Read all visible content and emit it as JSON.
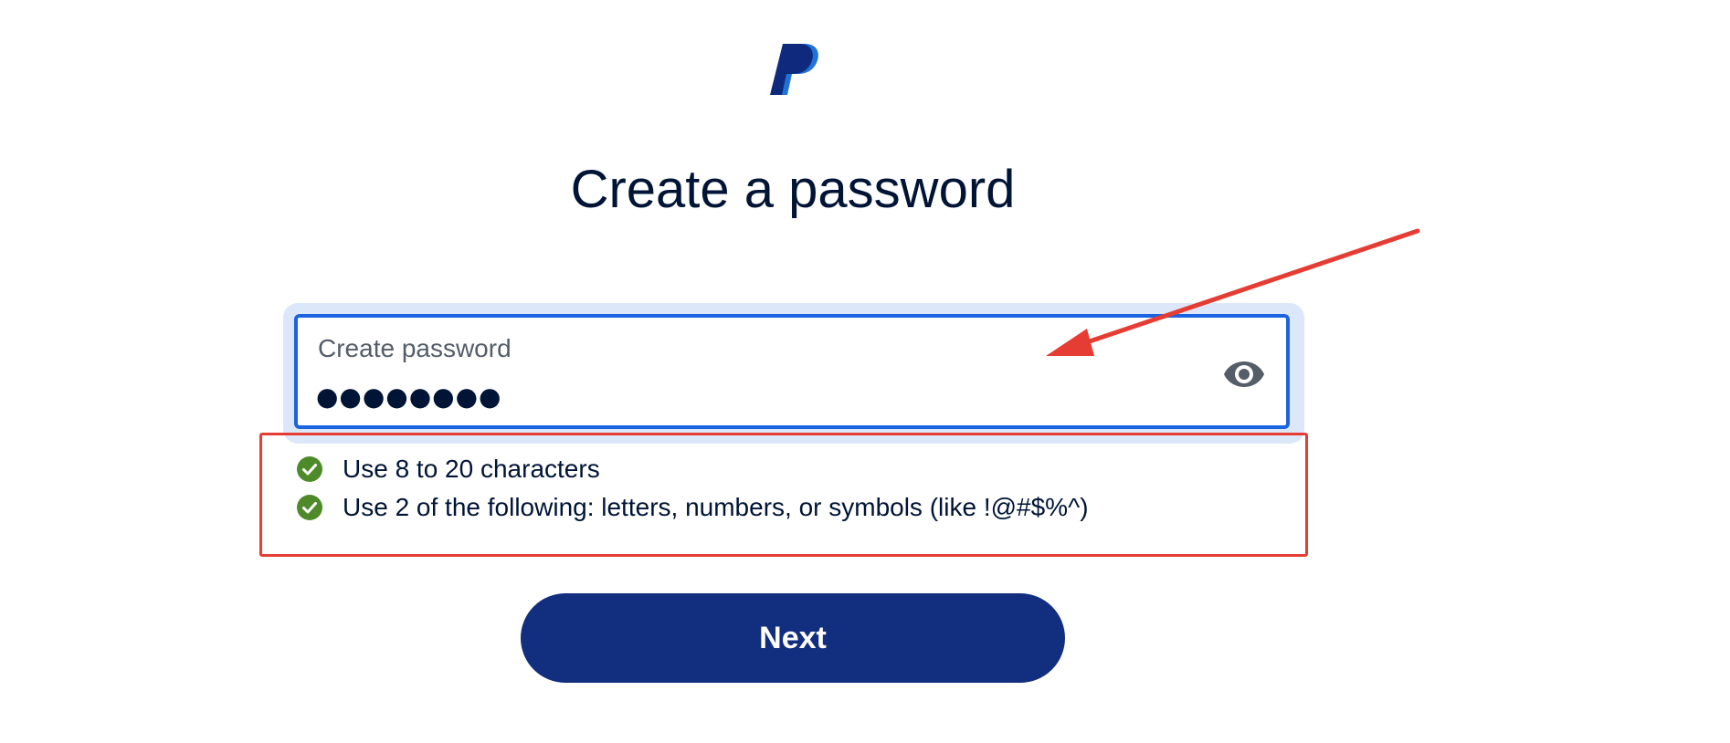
{
  "logo": {
    "icon": "paypal-logo-icon",
    "colors": {
      "dark": "#0f2a7d",
      "light": "#1f73d9"
    }
  },
  "page_title": "Create a password",
  "password_field": {
    "label": "Create password",
    "value": "●●●●●●●●",
    "toggle_icon": "eye-icon"
  },
  "requirements": {
    "items": [
      {
        "text": "Use 8 to 20 characters",
        "status": "met",
        "icon": "check-circle-icon"
      },
      {
        "text": "Use 2 of the following: letters, numbers, or symbols (like !@#$%^)",
        "status": "met",
        "icon": "check-circle-icon"
      }
    ],
    "met_color": "#4f8a2a"
  },
  "next_button": {
    "label": "Next"
  },
  "colors": {
    "accent": "#1a64df",
    "primary_button": "#122e7e",
    "annotation": "#e53d34",
    "text": "#001435"
  }
}
